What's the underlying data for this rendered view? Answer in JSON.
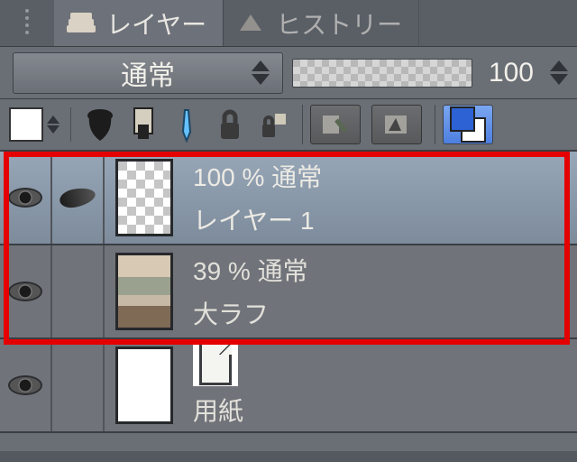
{
  "tabs": {
    "layers": {
      "label": "レイヤー"
    },
    "history": {
      "label": "ヒストリー"
    }
  },
  "blend": {
    "mode": "通常",
    "opacity": "100"
  },
  "tools": {
    "clip_alpha": "clip-alpha",
    "mask": "mask-icon",
    "pen": "pen-icon",
    "lock": "lock-icon",
    "lock_small": "lock-alpha-icon",
    "mask_btn1": "mask-add-icon",
    "mask_btn2": "mask-enable-icon",
    "fg_bg": "fg-bg-swatch"
  },
  "layers": [
    {
      "opacity_mode": "100 % 通常",
      "name": "レイヤー 1",
      "selected": true,
      "visible": true,
      "editing": true,
      "thumb": "checker"
    },
    {
      "opacity_mode": "39 % 通常",
      "name": "大ラフ",
      "selected": false,
      "visible": true,
      "editing": false,
      "thumb": "image"
    },
    {
      "opacity_mode": "",
      "name": "用紙",
      "selected": false,
      "visible": true,
      "editing": false,
      "thumb": "paper"
    }
  ],
  "annotation": {
    "label": "highlighted-layers"
  }
}
